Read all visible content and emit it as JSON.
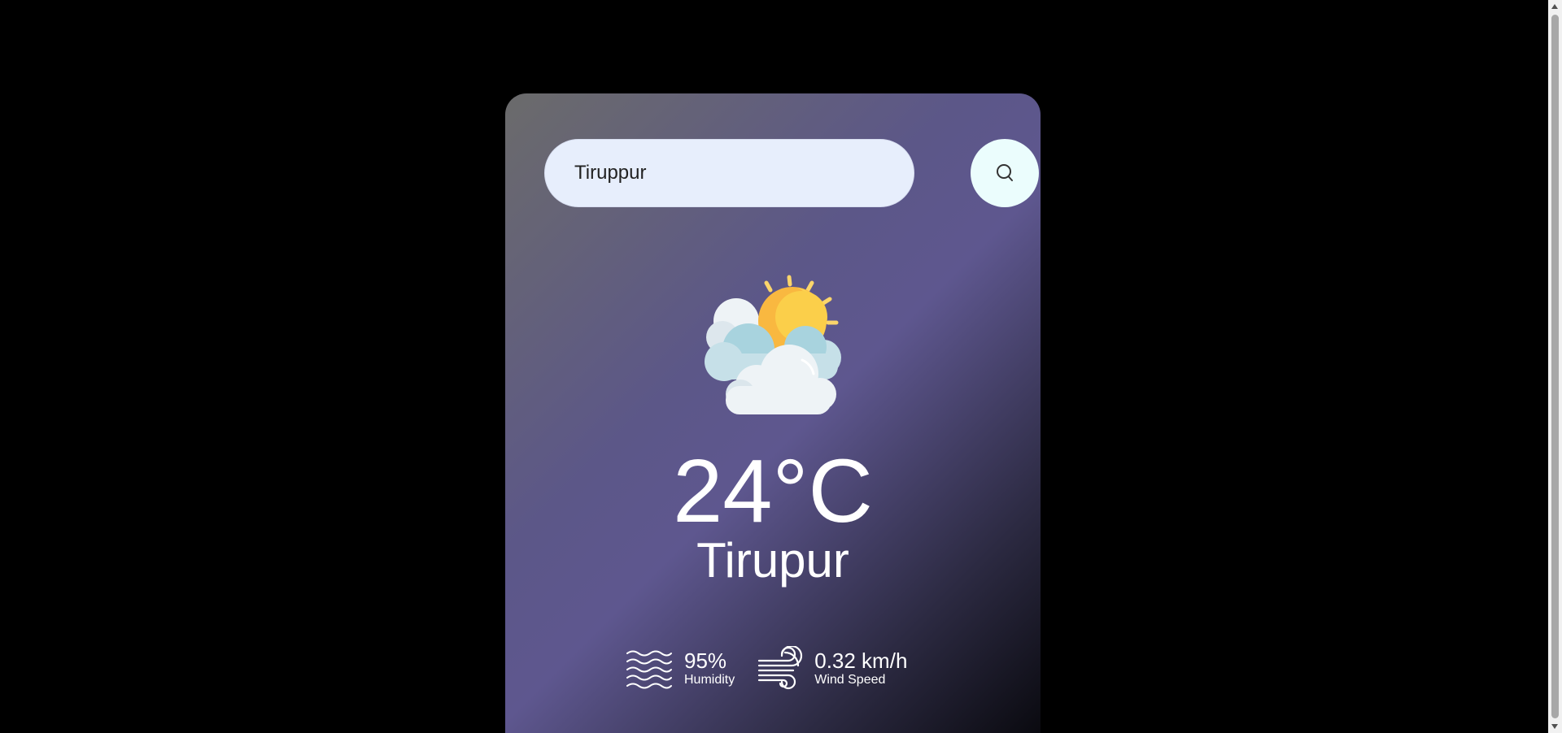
{
  "search": {
    "value": "Tiruppur",
    "button_icon": "search-icon"
  },
  "weather": {
    "icon": "partly-cloudy-icon",
    "temperature": "24°C",
    "city": "Tirupur"
  },
  "humidity": {
    "icon": "humidity-waves-icon",
    "value": "95%",
    "label": "Humidity"
  },
  "wind": {
    "icon": "wind-icon",
    "value": "0.32 km/h",
    "label": "Wind Speed"
  },
  "colors": {
    "page_background": "#000000",
    "input_background": "#e7eefc",
    "button_background": "#ebfdfd",
    "card_gradient_start": "#6b6b6b",
    "card_gradient_mid": "#5e578f",
    "card_gradient_end": "#050508",
    "text": "#ffffff"
  }
}
